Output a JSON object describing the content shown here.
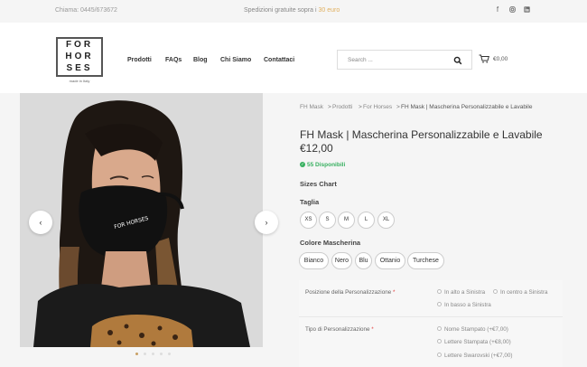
{
  "topbar": {
    "phone": "Chiama: 0445/673672",
    "promo_prefix": "Spedizioni gratuite sopra i",
    "promo_accent": "30 euro",
    "social": [
      "facebook-icon",
      "instagram-icon",
      "linkedin-icon"
    ]
  },
  "logo": {
    "rows": [
      "FOR",
      "HOR",
      "SES"
    ],
    "tagline": "made in Italy"
  },
  "nav": [
    "Prodotti",
    "FAQs",
    "Blog",
    "Chi Siamo",
    "Contattaci"
  ],
  "search": {
    "placeholder": "Search ..."
  },
  "cart": {
    "total": "€0,00"
  },
  "breadcrumb": {
    "items": [
      "FH Mask",
      "Prodotti",
      "For Horses",
      "FH Mask | Mascherina Personalizzabile e Lavabile"
    ],
    "separators": [
      ">",
      ">",
      ">"
    ]
  },
  "product": {
    "title": "FH Mask | Mascherina Personalizzabile e Lavabile",
    "price": "€12,00",
    "stock": "55 Disponibili",
    "sizes_chart": "Sizes Chart",
    "size_label": "Taglia",
    "sizes": [
      "XS",
      "S",
      "M",
      "L",
      "XL"
    ],
    "color_label": "Colore Mascherina",
    "colors": [
      "Bianco",
      "Nero",
      "Blu",
      "Ottanio",
      "Turchese"
    ]
  },
  "gallery": {
    "prev": "‹",
    "next": "›",
    "mask_print": "FOR HORSES"
  },
  "options": {
    "position": {
      "label": "Posizione della Personalizzazione",
      "required": "*",
      "choices": [
        "In alto a Sinistra",
        "In centro a Sinistra",
        "In basso a Sinistra"
      ]
    },
    "type": {
      "label": "Tipo di Personalizzazione",
      "required": "*",
      "choices": [
        "Nome Stampato (+€7,00)",
        "Lettere Stampata (+€8,00)",
        "Lettere Swarovski (+€7,00)"
      ]
    }
  },
  "colors": {
    "accent": "#c9a064",
    "stock": "#38b060",
    "required": "#e04040"
  }
}
